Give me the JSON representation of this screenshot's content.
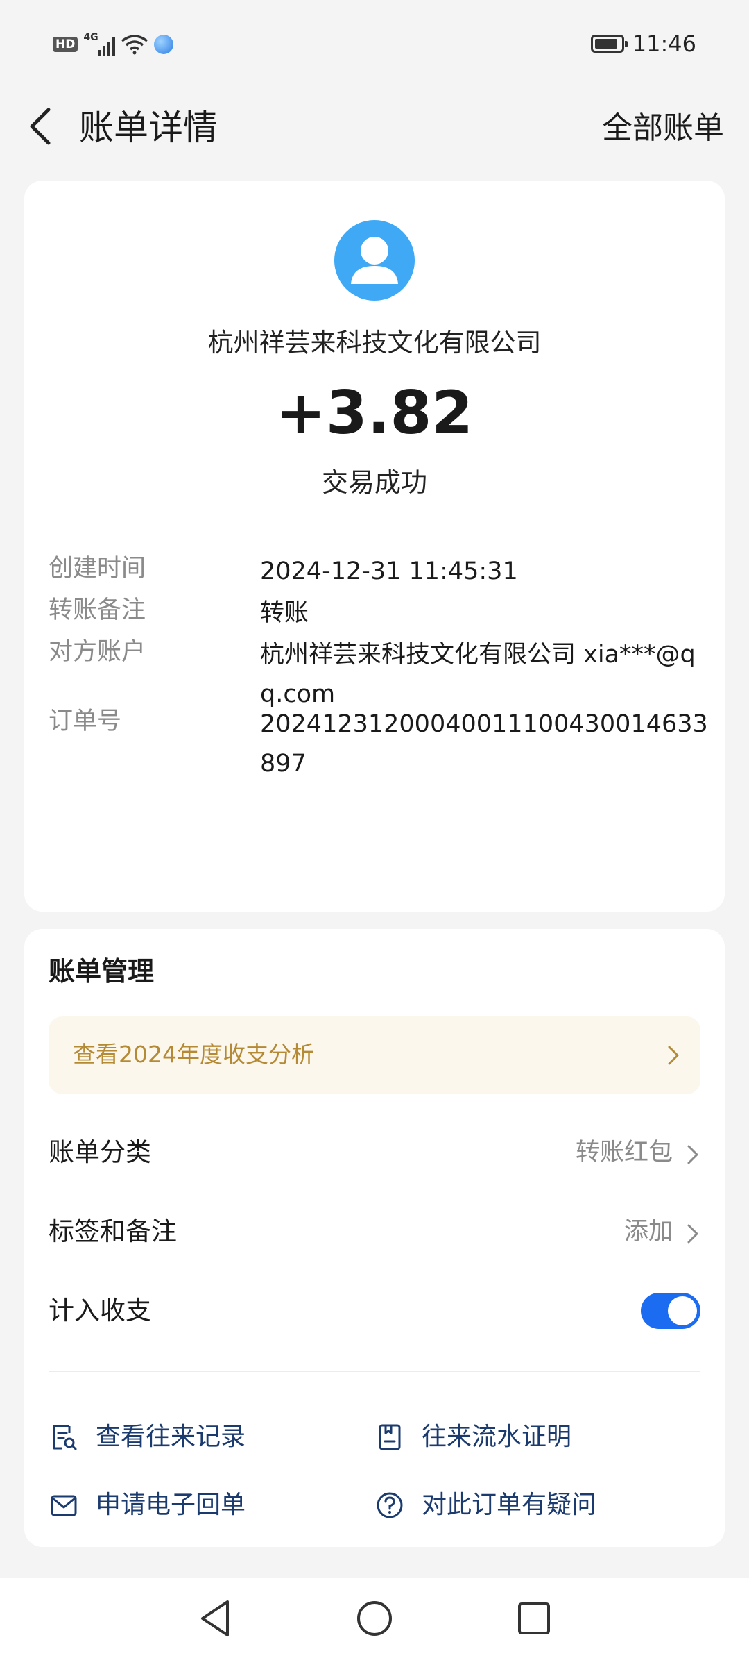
{
  "status_bar": {
    "hd_label": "HD",
    "network_label": "4G",
    "time": "11:46",
    "icons": [
      "hd-icon",
      "signal-4g-icon",
      "wifi-icon",
      "app-notification-icon",
      "battery-icon"
    ]
  },
  "header": {
    "title": "账单详情",
    "right_label": "全部账单"
  },
  "transaction": {
    "payee": "杭州祥芸来科技文化有限公司",
    "amount": "+3.82",
    "status": "交易成功",
    "details": [
      {
        "label": "创建时间",
        "value": "2024-12-31 11:45:31"
      },
      {
        "label": "转账备注",
        "value": "转账"
      },
      {
        "label": "对方账户",
        "value": "杭州祥芸来科技文化有限公司 xia***@qq.com"
      },
      {
        "label": "订单号",
        "value": "20241231200040011100430014633897"
      }
    ]
  },
  "management": {
    "title": "账单管理",
    "banner": "查看2024年度收支分析",
    "rows": [
      {
        "label": "账单分类",
        "value": "转账红包"
      },
      {
        "label": "标签和备注",
        "value": "添加"
      },
      {
        "label": "计入收支",
        "toggle_on": true
      }
    ],
    "links": [
      {
        "label": "查看往来记录",
        "icon": "record-search-icon"
      },
      {
        "label": "往来流水证明",
        "icon": "statement-icon"
      },
      {
        "label": "申请电子回单",
        "icon": "mail-icon"
      },
      {
        "label": "对此订单有疑问",
        "icon": "question-icon"
      }
    ]
  },
  "colors": {
    "accent_blue": "#1b6cf0",
    "avatar_blue": "#3fa9f5",
    "banner_text": "#b58a35",
    "link_text": "#1b3b6f"
  }
}
